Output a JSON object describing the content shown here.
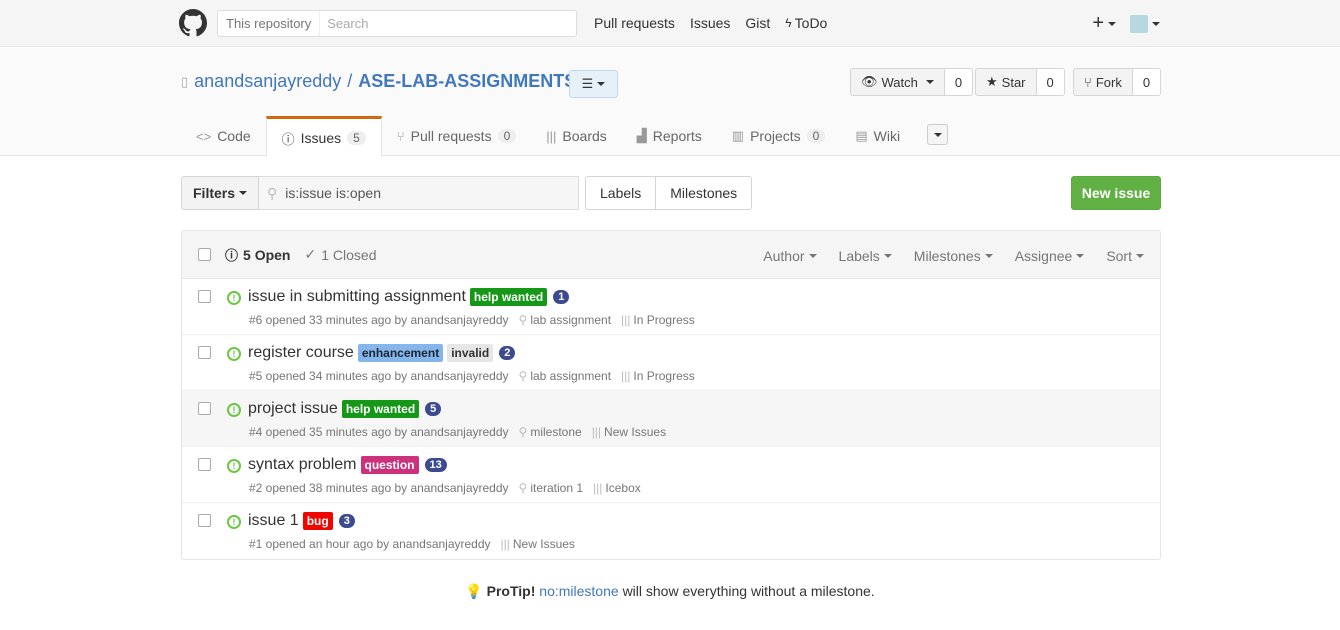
{
  "header": {
    "scope_label": "This repository",
    "search_placeholder": "Search",
    "nav": [
      "Pull requests",
      "Issues",
      "Gist",
      "ToDo"
    ],
    "todo_icon": "bolt-icon",
    "plus": "+"
  },
  "repo": {
    "owner": "anandsanjayreddy",
    "separator": "/",
    "name": "ASE-LAB-ASSIGNMENTS",
    "watch_label": "Watch",
    "watch_count": "0",
    "star_label": "Star",
    "star_count": "0",
    "fork_label": "Fork",
    "fork_count": "0"
  },
  "tabs": {
    "code": "Code",
    "issues": "Issues",
    "issues_count": "5",
    "pulls": "Pull requests",
    "pulls_count": "0",
    "boards": "Boards",
    "reports": "Reports",
    "projects": "Projects",
    "projects_count": "0",
    "wiki": "Wiki"
  },
  "filterbar": {
    "filters_label": "Filters",
    "query": "is:issue is:open",
    "labels_btn": "Labels",
    "milestones_btn": "Milestones",
    "new_issue": "New issue"
  },
  "list_header": {
    "open": "5 Open",
    "closed": "1 Closed",
    "author": "Author",
    "labels": "Labels",
    "milestones": "Milestones",
    "assignee": "Assignee",
    "sort": "Sort"
  },
  "issues": [
    {
      "title": "issue in submitting assignment",
      "labels": [
        {
          "text": "help wanted",
          "color": "#159818"
        }
      ],
      "count": "1",
      "meta": "#6 opened 33 minutes ago by anandsanjayreddy",
      "milestone": "lab assignment",
      "pipeline": "In Progress"
    },
    {
      "title": "register course",
      "labels": [
        {
          "text": "enhancement",
          "color": "#84b6eb"
        },
        {
          "text": "invalid",
          "color": "#e6e6e6"
        }
      ],
      "count": "2",
      "meta": "#5 opened 34 minutes ago by anandsanjayreddy",
      "milestone": "lab assignment",
      "pipeline": "In Progress"
    },
    {
      "title": "project issue",
      "labels": [
        {
          "text": "help wanted",
          "color": "#159818"
        }
      ],
      "count": "5",
      "meta": "#4 opened 35 minutes ago by anandsanjayreddy",
      "milestone": "milestone",
      "pipeline": "New Issues"
    },
    {
      "title": "syntax problem",
      "labels": [
        {
          "text": "question",
          "color": "#cc317c"
        }
      ],
      "count": "13",
      "meta": "#2 opened 38 minutes ago by anandsanjayreddy",
      "milestone": "iteration 1",
      "pipeline": "Icebox"
    },
    {
      "title": "issue 1",
      "labels": [
        {
          "text": "bug",
          "color": "#ee0701"
        }
      ],
      "count": "3",
      "meta": "#1 opened an hour ago by anandsanjayreddy",
      "milestone": "",
      "pipeline": "New Issues"
    }
  ],
  "protip": {
    "lead": "ProTip!",
    "link": "no:milestone",
    "rest": "will show everything without a milestone."
  }
}
